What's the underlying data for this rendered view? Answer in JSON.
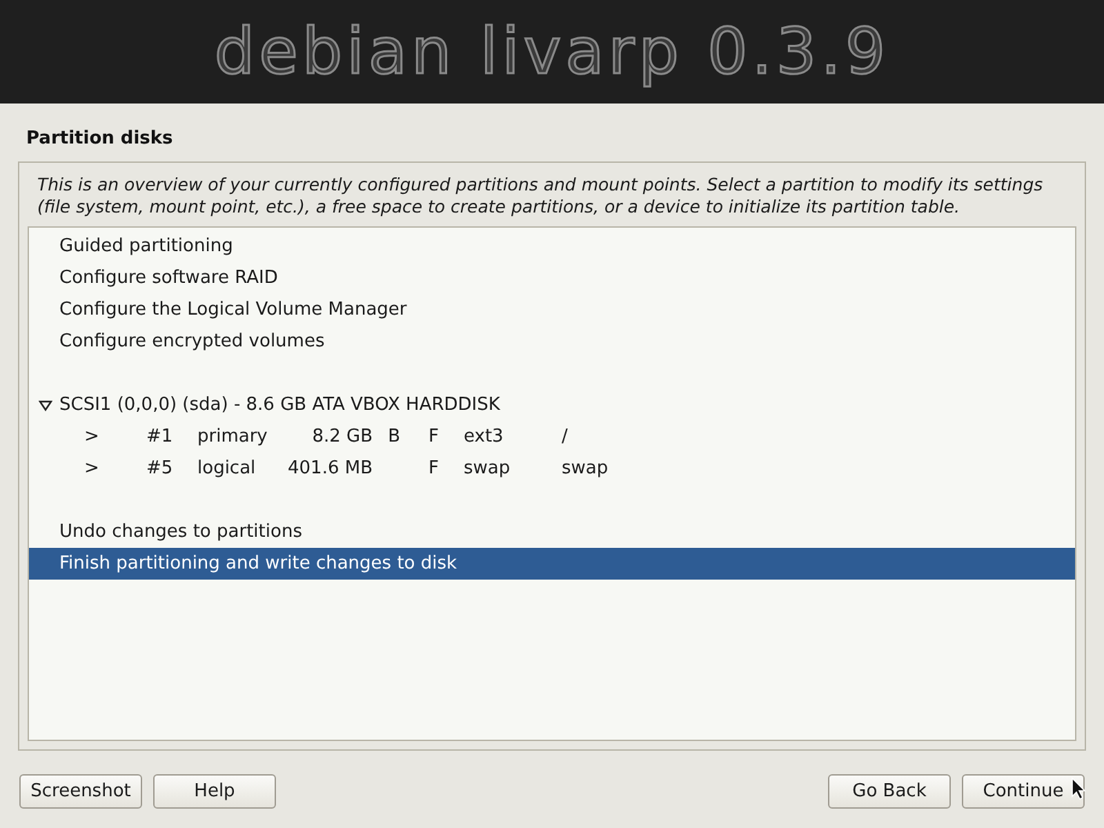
{
  "banner": {
    "title": "debian livarp 0.3.9"
  },
  "page": {
    "title": "Partition disks",
    "intro": "This is an overview of your currently configured partitions and mount points. Select a partition to modify its settings (file system, mount point, etc.), a free space to create partitions, or a device to initialize its partition table."
  },
  "list": {
    "groups": [
      {
        "items": [
          {
            "kind": "option",
            "label": "Guided partitioning",
            "selected": false
          },
          {
            "kind": "option",
            "label": "Configure software RAID",
            "selected": false
          },
          {
            "kind": "option",
            "label": "Configure the Logical Volume Manager",
            "selected": false
          },
          {
            "kind": "option",
            "label": "Configure encrypted volumes",
            "selected": false
          }
        ]
      },
      {
        "items": [
          {
            "kind": "disk",
            "label": "SCSI1 (0,0,0) (sda) - 8.6 GB ATA VBOX HARDDISK",
            "expanded": true,
            "selected": false
          },
          {
            "kind": "partition",
            "marker": ">",
            "number": "#1",
            "type": "primary",
            "size": "8.2 GB",
            "bootable": "B",
            "format": "F",
            "filesystem": "ext3",
            "mount": "/",
            "selected": false
          },
          {
            "kind": "partition",
            "marker": ">",
            "number": "#5",
            "type": "logical",
            "size": "401.6 MB",
            "format": "F",
            "filesystem": "swap",
            "mount": "swap",
            "selected": false
          }
        ]
      },
      {
        "items": [
          {
            "kind": "option",
            "label": "Undo changes to partitions",
            "selected": false
          },
          {
            "kind": "option",
            "label": "Finish partitioning and write changes to disk",
            "selected": true
          }
        ]
      }
    ]
  },
  "buttons_left": [
    "Screenshot",
    "Help"
  ],
  "buttons_right": [
    "Go Back",
    "Continue"
  ]
}
